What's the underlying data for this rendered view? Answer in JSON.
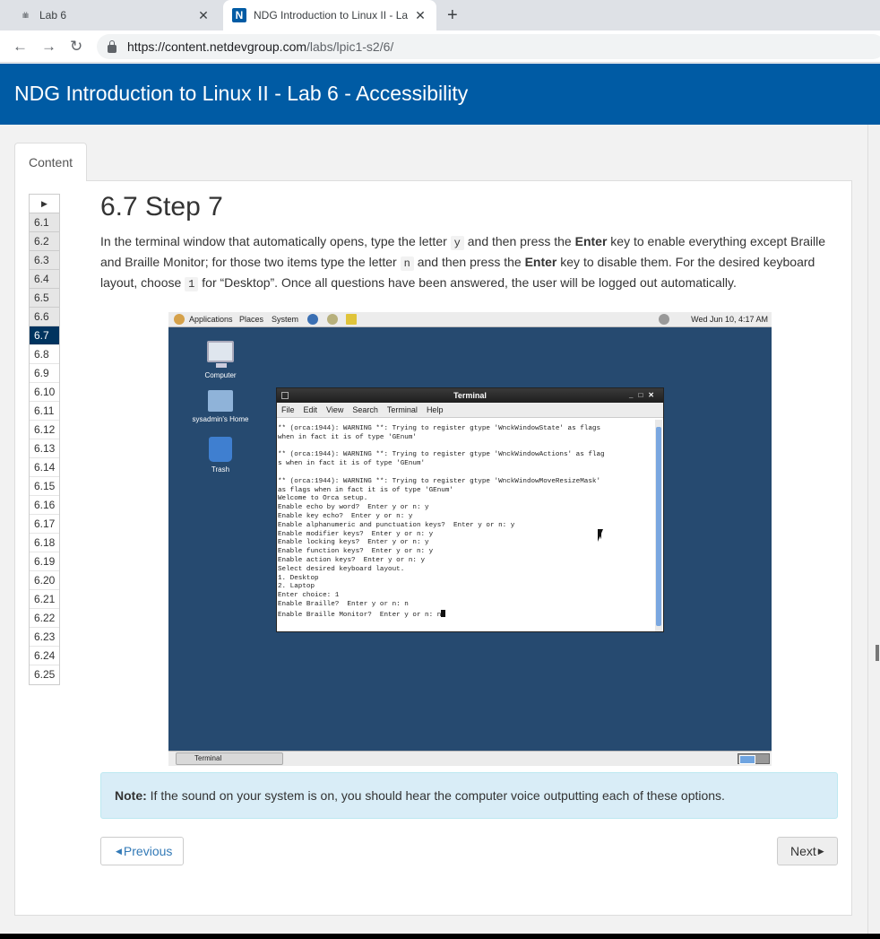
{
  "browser": {
    "tabs": [
      {
        "title": "Lab 6",
        "favicon": "cisco-icon",
        "active": false
      },
      {
        "title": "NDG Introduction to Linux II - La",
        "favicon": "ndg-n-icon",
        "active": true
      }
    ],
    "url_host": "https://content.netdevgroup.com",
    "url_path": "/labs/lpic1-s2/6/"
  },
  "page": {
    "title": "NDG Introduction to Linux II - Lab 6 - Accessibility",
    "content_tab": "Content"
  },
  "step_nav": {
    "items": [
      "6.1",
      "6.2",
      "6.3",
      "6.4",
      "6.5",
      "6.6",
      "6.7",
      "6.8",
      "6.9",
      "6.10",
      "6.11",
      "6.12",
      "6.13",
      "6.14",
      "6.15",
      "6.16",
      "6.17",
      "6.18",
      "6.19",
      "6.20",
      "6.21",
      "6.22",
      "6.23",
      "6.24",
      "6.25"
    ],
    "active": "6.7"
  },
  "step": {
    "heading": "6.7 Step 7",
    "p1": "In the terminal window that automatically opens, type the letter ",
    "code_y": "y",
    "p2": " and then press the ",
    "enter1": "Enter",
    "p3": " key to enable everything except Braille and Braille Monitor; for those two items type the letter ",
    "code_n": "n",
    "p4": " and then press the ",
    "enter2": "Enter",
    "p5": " key to disable them. For the desired keyboard layout, choose ",
    "code_1": "1",
    "p6": " for “Desktop”. Once all questions have been answered, the user will be logged out automatically."
  },
  "vm": {
    "menu": [
      "Applications",
      "Places",
      "System"
    ],
    "clock": "Wed Jun 10,  4:17 AM",
    "desktop_icons": [
      "Computer",
      "sysadmin's Home",
      "Trash"
    ],
    "terminal_title": "Terminal",
    "terminal_menu": [
      "File",
      "Edit",
      "View",
      "Search",
      "Terminal",
      "Help"
    ],
    "terminal_lines": "** (orca:1944): WARNING **: Trying to register gtype 'WnckWindowState' as flags\nwhen in fact it is of type 'GEnum'\n\n** (orca:1944): WARNING **: Trying to register gtype 'WnckWindowActions' as flag\ns when in fact it is of type 'GEnum'\n\n** (orca:1944): WARNING **: Trying to register gtype 'WnckWindowMoveResizeMask'\nas flags when in fact it is of type 'GEnum'\nWelcome to Orca setup.\nEnable echo by word?  Enter y or n: y\nEnable key echo?  Enter y or n: y\nEnable alphanumeric and punctuation keys?  Enter y or n: y\nEnable modifier keys?  Enter y or n: y\nEnable locking keys?  Enter y or n: y\nEnable function keys?  Enter y or n: y\nEnable action keys?  Enter y or n: y\nSelect desired keyboard layout.\n1. Desktop\n2. Laptop\nEnter choice: 1\nEnable Braille?  Enter y or n: n\nEnable Braille Monitor?  Enter y or n: n",
    "taskbar_item": "Terminal"
  },
  "note": {
    "label": "Note:",
    "text": " If the sound on your system is on, you should hear the computer voice outputting each of these options."
  },
  "buttons": {
    "previous": "Previous",
    "next": "Next"
  }
}
